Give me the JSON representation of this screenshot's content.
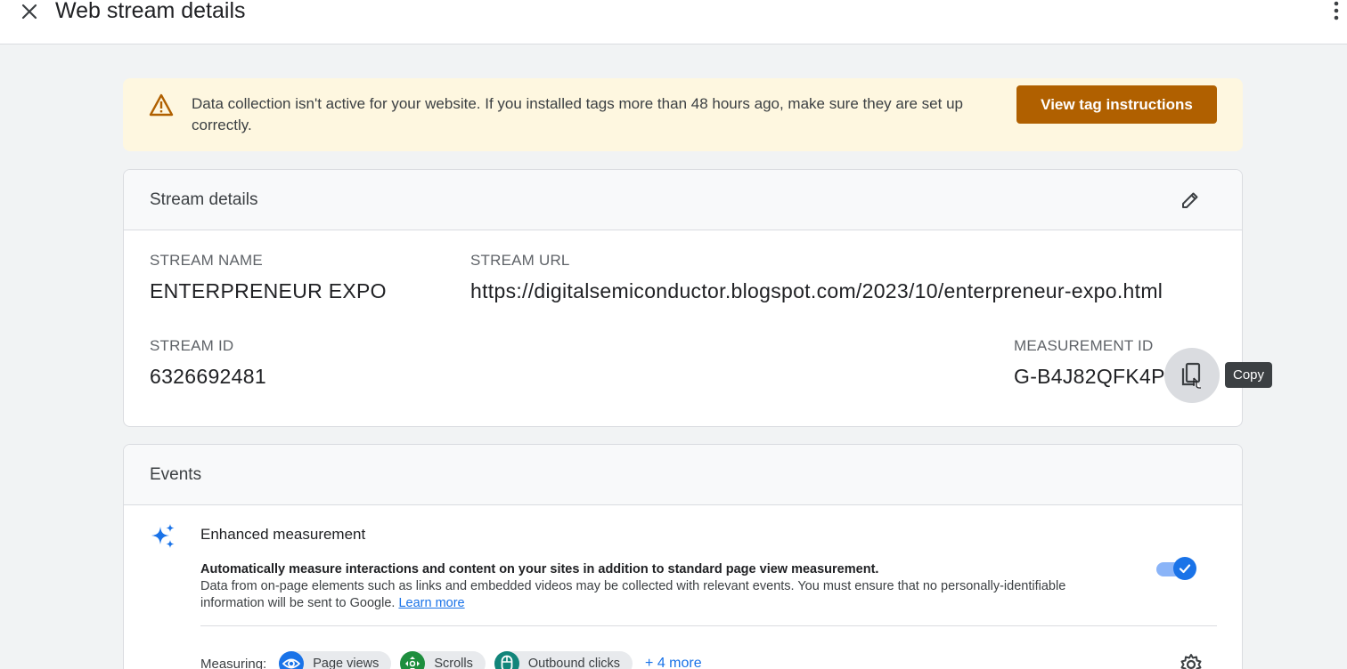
{
  "header": {
    "title": "Web stream details",
    "close_icon": "close-icon",
    "more_icon": "more-vert-icon"
  },
  "banner": {
    "icon": "warning-icon",
    "message": "Data collection isn't active for your website. If you installed tags more than 48 hours ago, make sure they are set up correctly.",
    "button_label": "View tag instructions",
    "button_color": "#b06000",
    "background": "#fef7e0"
  },
  "stream_details": {
    "title": "Stream details",
    "edit_icon": "pencil-icon",
    "stream_name_label": "STREAM NAME",
    "stream_name": "ENTERPRENEUR EXPO",
    "stream_url_label": "STREAM URL",
    "stream_url": "https://digitalsemiconductor.blogspot.com/2023/10/enterpreneur-expo.html",
    "stream_id_label": "STREAM ID",
    "stream_id": "6326692481",
    "measurement_id_label": "MEASUREMENT ID",
    "measurement_id": "G-B4J82QFK4P",
    "copy_icon": "copy-icon",
    "copy_tooltip": "Copy"
  },
  "events": {
    "title": "Events",
    "enhanced": {
      "icon": "sparkle-icon",
      "title": "Enhanced measurement",
      "desc_bold": "Automatically measure interactions and content on your sites in addition to standard page view measurement.",
      "desc_rest": "Data from on-page elements such as links and embedded videos may be collected with relevant events. You must ensure that no personally-identifiable information will be sent to Google.",
      "learn_more": "Learn more",
      "toggle_on": true,
      "accent": "#1a73e8"
    },
    "measuring_label": "Measuring:",
    "chips": [
      {
        "label": "Page views",
        "icon": "eye-icon",
        "color": "#1a73e8"
      },
      {
        "label": "Scrolls",
        "icon": "scroll-icon",
        "color": "#1e8e3e"
      },
      {
        "label": "Outbound clicks",
        "icon": "mouse-icon",
        "color": "#12857a"
      }
    ],
    "more_link": "+ 4 more",
    "settings_icon": "gear-icon"
  }
}
